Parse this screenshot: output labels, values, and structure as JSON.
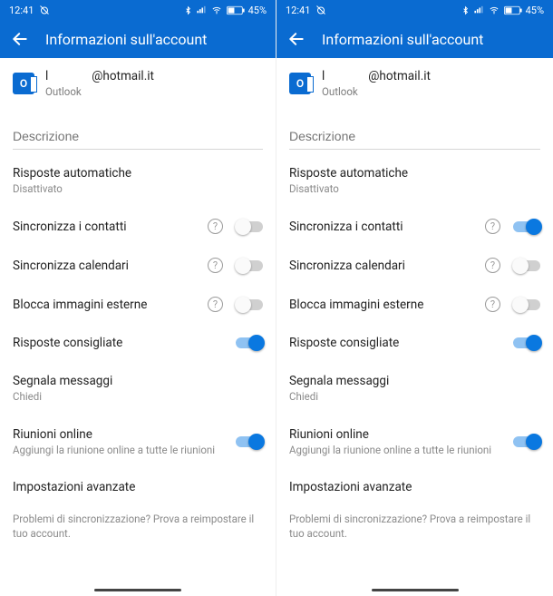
{
  "screens": [
    {
      "status": {
        "time": "12:41",
        "battery": "45%"
      },
      "appbar": {
        "title": "Informazioni sull'account"
      },
      "account": {
        "email_prefix": "l",
        "email_suffix": "@hotmail.it",
        "provider": "Outlook"
      },
      "description": {
        "placeholder": "Descrizione"
      },
      "items": {
        "auto_replies": {
          "title": "Risposte automatiche",
          "sub": "Disattivato"
        },
        "sync_contacts": {
          "title": "Sincronizza i contatti",
          "help": true,
          "toggle": false
        },
        "sync_calendar": {
          "title": "Sincronizza calendari",
          "help": true,
          "toggle": false
        },
        "block_images": {
          "title": "Blocca immagini esterne",
          "help": true,
          "toggle": false
        },
        "suggested": {
          "title": "Risposte consigliate",
          "toggle": true
        },
        "report_msg": {
          "title": "Segnala messaggi",
          "sub": "Chiedi"
        },
        "online_meet": {
          "title": "Riunioni online",
          "sub": "Aggiungi la riunione online a tutte le riunioni",
          "toggle": true
        },
        "advanced": {
          "title": "Impostazioni avanzate"
        }
      },
      "footer": "Problemi di sincronizzazione? Prova a reimpostare il tuo account."
    },
    {
      "status": {
        "time": "12:41",
        "battery": "45%"
      },
      "appbar": {
        "title": "Informazioni sull'account"
      },
      "account": {
        "email_prefix": "l",
        "email_suffix": "@hotmail.it",
        "provider": "Outlook"
      },
      "description": {
        "placeholder": "Descrizione"
      },
      "items": {
        "auto_replies": {
          "title": "Risposte automatiche",
          "sub": "Disattivato"
        },
        "sync_contacts": {
          "title": "Sincronizza i contatti",
          "help": true,
          "toggle": true
        },
        "sync_calendar": {
          "title": "Sincronizza calendari",
          "help": true,
          "toggle": false
        },
        "block_images": {
          "title": "Blocca immagini esterne",
          "help": true,
          "toggle": false
        },
        "suggested": {
          "title": "Risposte consigliate",
          "toggle": true
        },
        "report_msg": {
          "title": "Segnala messaggi",
          "sub": "Chiedi"
        },
        "online_meet": {
          "title": "Riunioni online",
          "sub": "Aggiungi la riunione online a tutte le riunioni",
          "toggle": true
        },
        "advanced": {
          "title": "Impostazioni avanzate"
        }
      },
      "footer": "Problemi di sincronizzazione? Prova a reimpostare il tuo account."
    }
  ]
}
